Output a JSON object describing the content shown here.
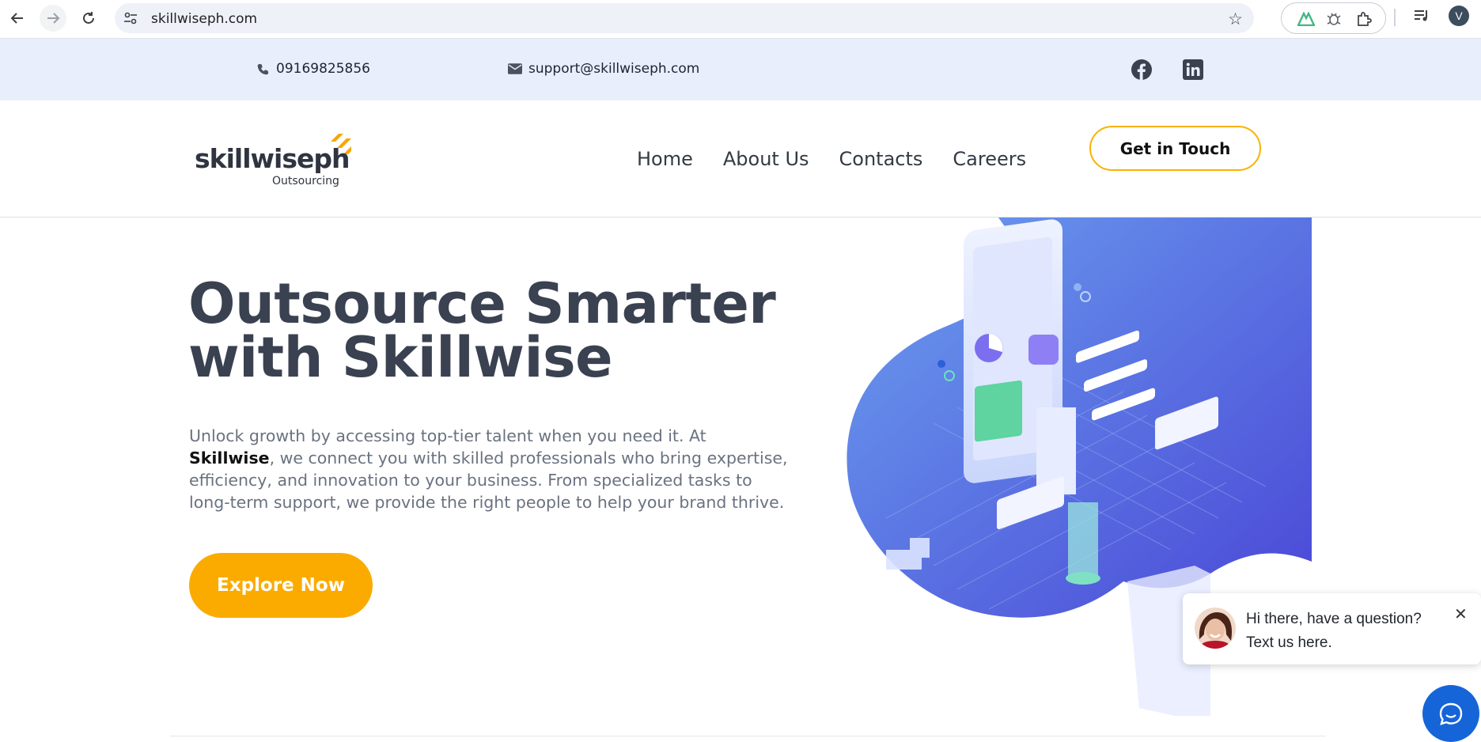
{
  "browser": {
    "url": "skillwiseph.com",
    "profile_initial": "V"
  },
  "topbar": {
    "phone": "09169825856",
    "email": "support@skillwiseph.com"
  },
  "header": {
    "logo_word": "skillwiseph",
    "logo_sub": "Outsourcing",
    "menu": [
      "Home",
      "About Us",
      "Contacts",
      "Careers"
    ],
    "cta": "Get in Touch"
  },
  "hero": {
    "title_line1": "Outsource Smarter",
    "title_line2": "with Skillwise",
    "text_before": "Unlock growth by accessing top-tier talent when you need it. At ",
    "text_brand": "Skillwise",
    "text_after": ", we connect you with skilled professionals who bring expertise, efficiency, and innovation to your business. From specialized tasks to long-term support, we provide the right people to help your brand thrive.",
    "cta": "Explore Now"
  },
  "chat": {
    "line1": "Hi there, have a question?",
    "line2": "Text us here."
  },
  "colors": {
    "accent": "#fbab00",
    "topbar_bg": "#e8eefc",
    "chat_blue": "#1565d8",
    "illustration_blue": "#4f6ce0"
  }
}
